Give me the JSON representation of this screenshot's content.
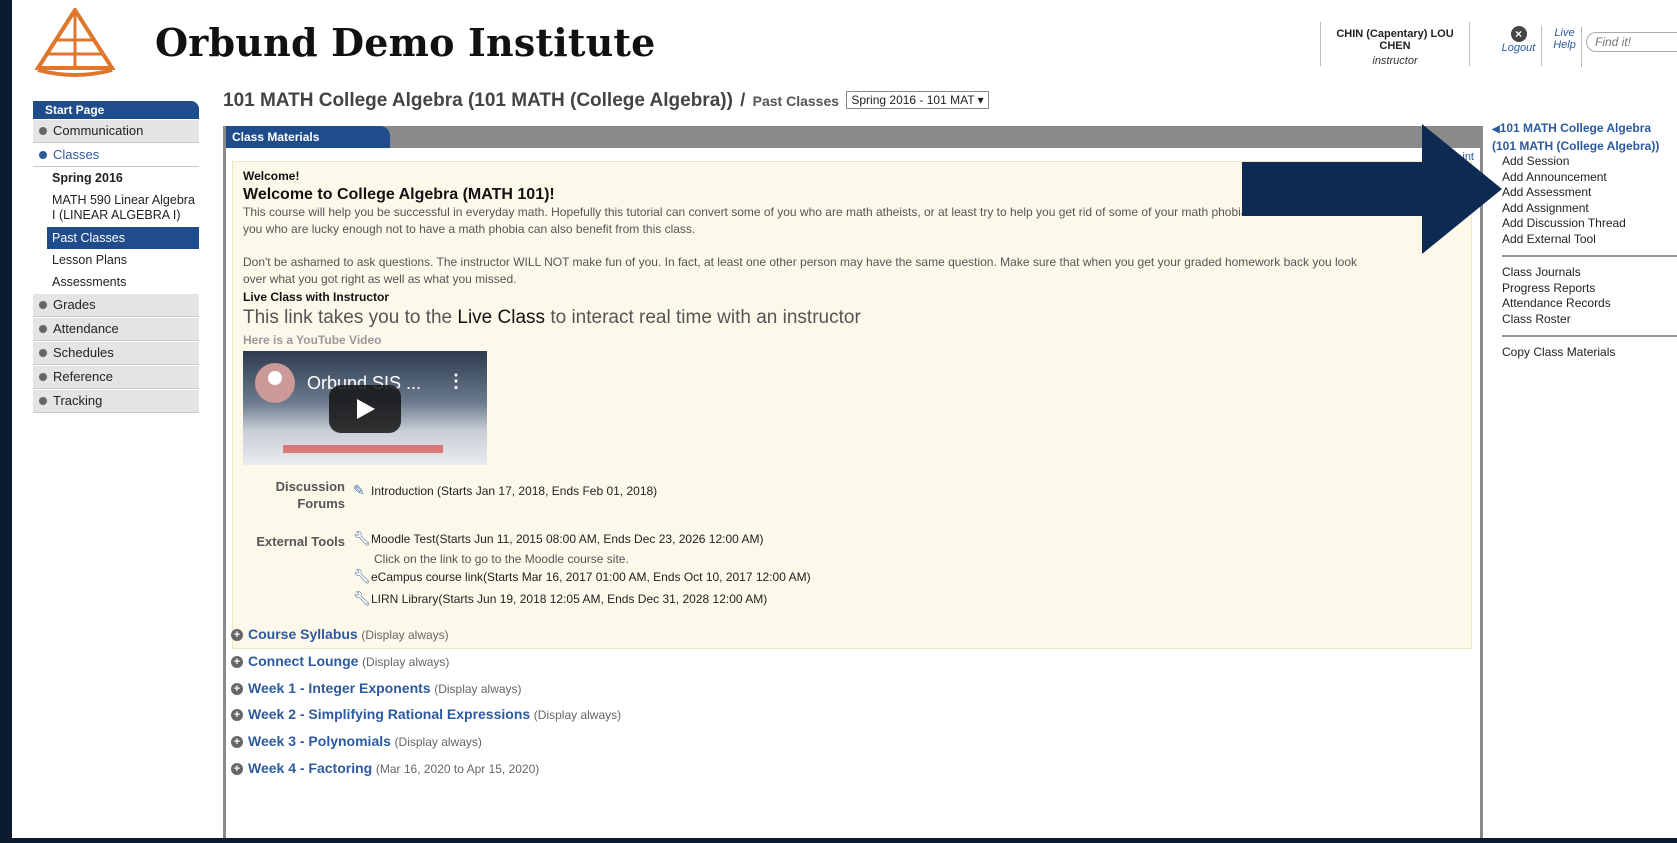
{
  "header": {
    "site_title": "Orbund Demo Institute",
    "user_name": "CHIN (Capentary) LOU CHEN",
    "user_role": "instructor",
    "logout_label": "Logout",
    "live_label": "Live",
    "help_label": "Help",
    "find_placeholder": "Find it!"
  },
  "left_nav": {
    "start_page": "Start Page",
    "items": [
      {
        "label": "Communication"
      },
      {
        "label": "Classes"
      },
      {
        "label": "Grades"
      },
      {
        "label": "Attendance"
      },
      {
        "label": "Schedules"
      },
      {
        "label": "Reference"
      },
      {
        "label": "Tracking"
      }
    ],
    "classes_sub": {
      "term": "Spring 2016",
      "course": "MATH 590 Linear Algebra I (LINEAR ALGEBRA I)",
      "past_classes": "Past Classes",
      "lesson_plans": "Lesson Plans",
      "assessments": "Assessments"
    }
  },
  "breadcrumb": {
    "course_title": "101 MATH College Algebra (101 MATH (College Algebra))",
    "separator": "/",
    "past_classes": "Past Classes",
    "term_select": "Spring 2016  - 101 MAT ▾"
  },
  "materials": {
    "tab_label": "Class Materials",
    "print_label": "int",
    "welcome_label": "Welcome!",
    "welcome_heading": "Welcome to College Algebra (MATH 101)!",
    "para1_line1": "This course will help you be successful in everyday math. Hopefully this tutorial can convert some of you who are math atheists, or at least try to help you get rid of some of your math phobia.  Those of",
    "para1_line2": "you who are lucky enough not to have a math phobia can also benefit from this class.",
    "para2_line1": "Don't be ashamed to ask questions.  The instructor WILL NOT make fun of you.  In fact, at least one other person may have the same question. Make sure that when you get your graded homework back you look",
    "para2_line2": "over what you got right as well as what you missed.",
    "live_class_label": "Live Class with Instructor",
    "live_line_pre": "This link takes you to the ",
    "live_line_link": "Live Class",
    "live_line_post": " to interact real time with an instructor",
    "youtube_label": "Here is a YouTube Video",
    "video_title": "Orbund SIS ...",
    "discussion_label_1": "Discussion",
    "discussion_label_2": "Forums",
    "discussion_item": "Introduction (Starts Jan 17, 2018, Ends Feb 01, 2018)",
    "external_label": "External Tools",
    "tools": [
      {
        "text": "Moodle Test(Starts Jun 11, 2015 08:00 AM, Ends Dec 23, 2026 12:00 AM)"
      },
      {
        "text": "eCampus course link(Starts Mar 16, 2017 01:00 AM, Ends Oct 10, 2017 12:00 AM)"
      },
      {
        "text": "LIRN Library(Starts Jun 19, 2018 12:05 AM, Ends Dec 31, 2028 12:00 AM)"
      }
    ],
    "moodle_note": "Click on the link to go to the Moodle course site.",
    "sections": [
      {
        "title": "Course Syllabus",
        "note": "(Display always)"
      },
      {
        "title": "Connect Lounge",
        "note": "(Display always)"
      },
      {
        "title": "Week 1 - Integer Exponents",
        "note": "(Display always)"
      },
      {
        "title": "Week 2 - Simplifying Rational Expressions",
        "note": "(Display always)"
      },
      {
        "title": "Week 3 - Polynomials",
        "note": "(Display always)"
      },
      {
        "title": "Week 4 - Factoring",
        "note": "(Mar 16, 2020 to Apr 15, 2020)"
      }
    ]
  },
  "right_panel": {
    "title": "101 MATH College Algebra (101 MATH (College Algebra))",
    "group1": [
      "Add Session",
      "Add Announcement",
      "Add Assessment",
      "Add Assignment",
      "Add Discussion Thread",
      "Add External Tool"
    ],
    "group2": [
      "Class Journals",
      "Progress Reports",
      "Attendance Records",
      "Class Roster"
    ],
    "group3": [
      "Copy Class Materials"
    ]
  },
  "colors": {
    "brand_blue": "#1f4d8c",
    "link_blue": "#2c5aa0",
    "arrow": "#0d2b52",
    "welcome_bg": "#fdf9ea"
  },
  "icons": {
    "logo": "logo-icon",
    "logout": "close-circle-icon",
    "tool": "wrench-icon",
    "expand": "plus-circle-icon",
    "play": "play-icon",
    "back": "triangle-left-icon"
  }
}
